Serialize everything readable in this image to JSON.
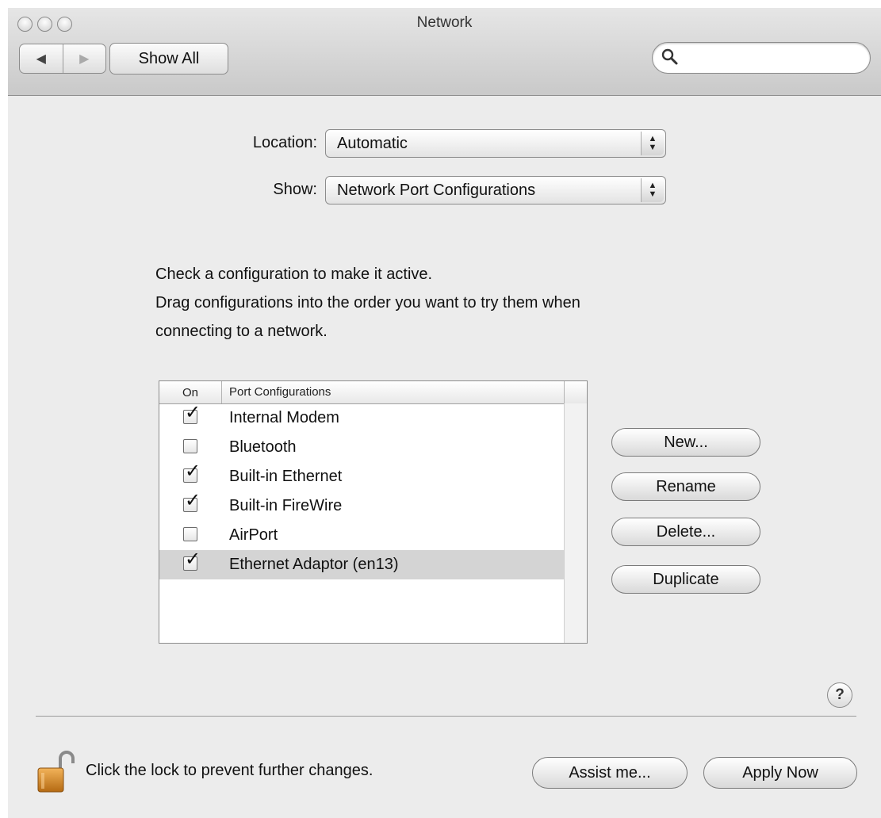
{
  "window": {
    "title": "Network"
  },
  "toolbar": {
    "back_icon": "triangle-left",
    "forward_icon": "triangle-right",
    "show_all_label": "Show All",
    "search": {
      "value": "",
      "placeholder": ""
    }
  },
  "location": {
    "label": "Location:",
    "value": "Automatic"
  },
  "show": {
    "label": "Show:",
    "value": "Network Port Configurations"
  },
  "instructions": {
    "line1": "Check a configuration to make it active.",
    "line2": "Drag configurations into the order you want to try them when",
    "line3": "connecting to a network."
  },
  "table": {
    "col_on": "On",
    "col_port": "Port Configurations",
    "rows": [
      {
        "name": "Internal Modem",
        "checked": true,
        "selected": false
      },
      {
        "name": "Bluetooth",
        "checked": false,
        "selected": false
      },
      {
        "name": "Built-in Ethernet",
        "checked": true,
        "selected": false
      },
      {
        "name": "Built-in FireWire",
        "checked": true,
        "selected": false
      },
      {
        "name": "AirPort",
        "checked": false,
        "selected": false
      },
      {
        "name": "Ethernet Adaptor (en13)",
        "checked": true,
        "selected": true
      }
    ]
  },
  "buttons": {
    "new": "New...",
    "rename": "Rename",
    "delete": "Delete...",
    "duplicate": "Duplicate",
    "help": "?",
    "assist": "Assist me...",
    "apply": "Apply Now"
  },
  "lock": {
    "text": "Click the lock to prevent further changes.",
    "state": "unlocked"
  }
}
